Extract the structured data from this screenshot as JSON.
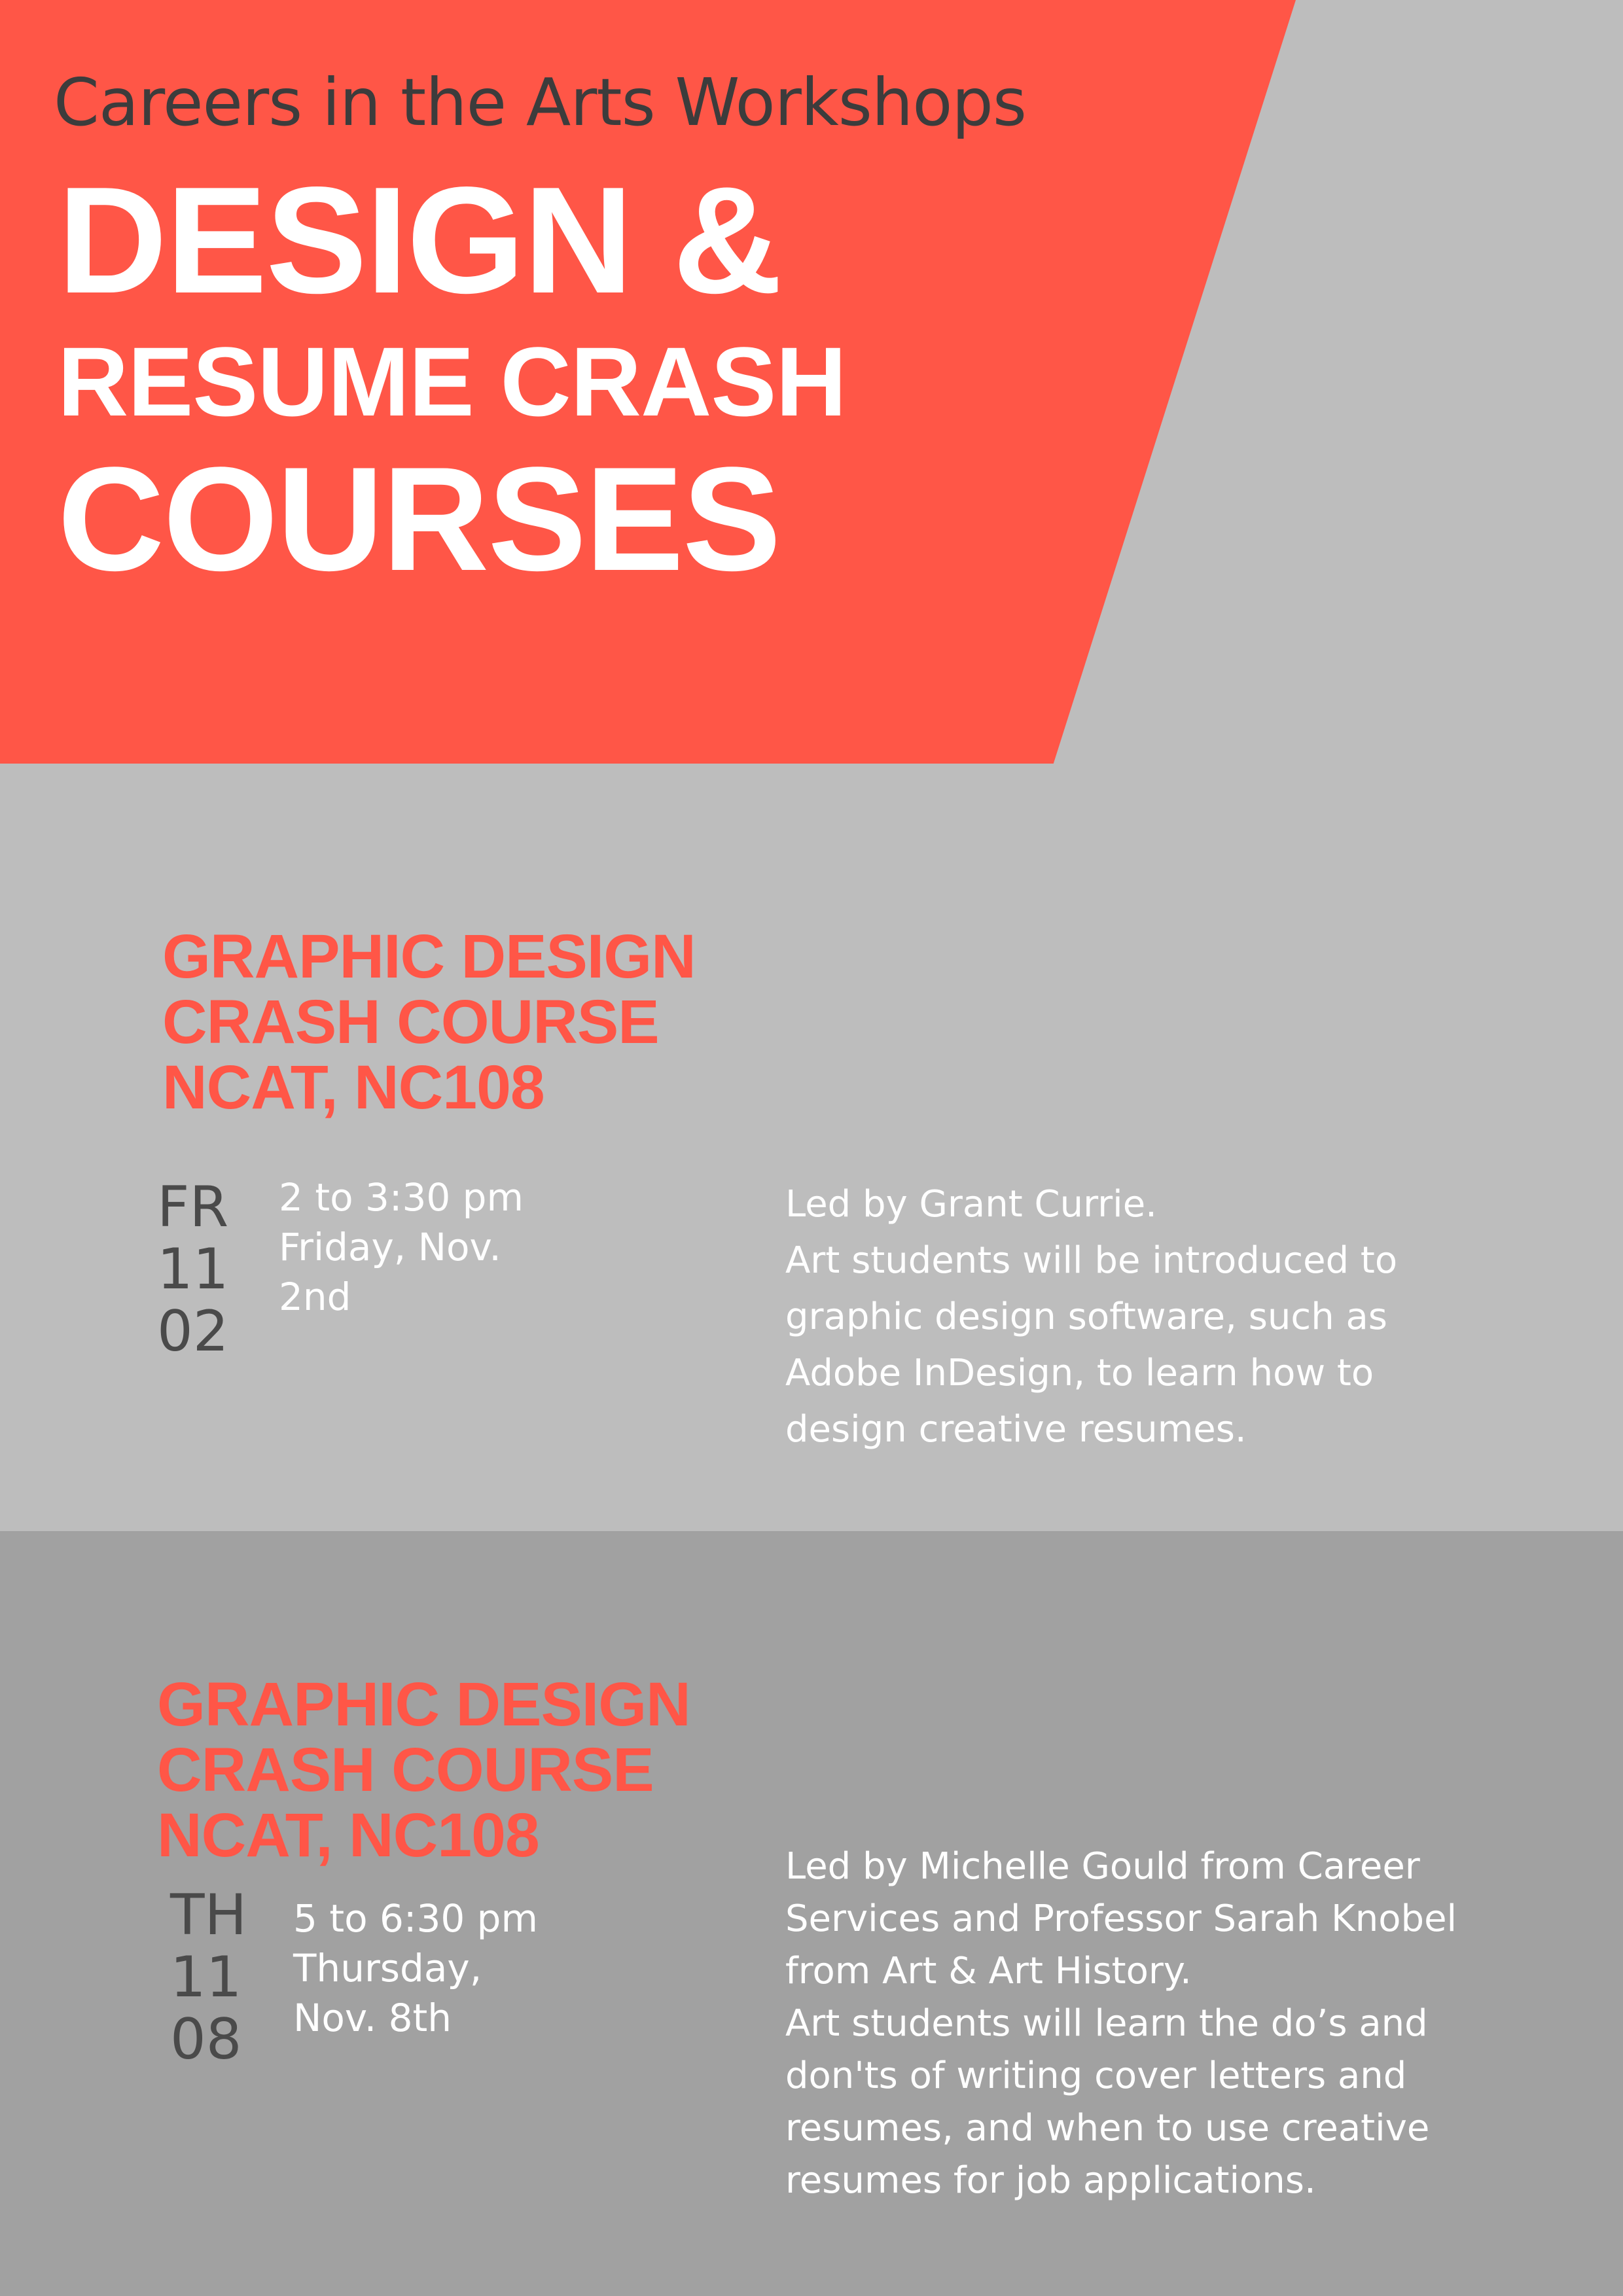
{
  "header": {
    "subtitle": "Careers in the Arts Workshops",
    "title_lines": [
      "DESIGN &",
      "RESUME CRASH",
      "COURSES"
    ]
  },
  "events": [
    {
      "heading_lines": [
        "GRAPHIC DESIGN",
        "CRASH COURSE",
        "NCAT, NC108"
      ],
      "day_abbrev": "FR",
      "month": "11",
      "day": "02",
      "time_lines": [
        "2 to 3:30 pm",
        "Friday, Nov.",
        "2nd"
      ],
      "description_lines": [
        "Led by Grant Currie.",
        "Art students will be introduced to",
        "graphic design software, such as",
        "Adobe InDesign, to learn how to",
        "design creative resumes."
      ]
    },
    {
      "heading_lines": [
        "GRAPHIC DESIGN",
        "CRASH COURSE",
        "NCAT, NC108"
      ],
      "day_abbrev": "TH",
      "month": "11",
      "day": "08",
      "time_lines": [
        "5 to 6:30 pm",
        "Thursday,",
        "Nov. 8th"
      ],
      "description_lines": [
        "Led by Michelle Gould from Career",
        "Services and Professor Sarah Knobel",
        "from Art & Art History.",
        "Art students will learn the do’s and",
        "don'ts of writing cover letters and",
        "resumes, and when to use creative",
        "resumes for job applications."
      ]
    }
  ],
  "colors": {
    "accent": "#ff5647",
    "background_light": "#bdbdbd",
    "background_dark": "#a1a1a1",
    "text_dark": "#3c3c3c",
    "text_light": "#ffffff"
  }
}
